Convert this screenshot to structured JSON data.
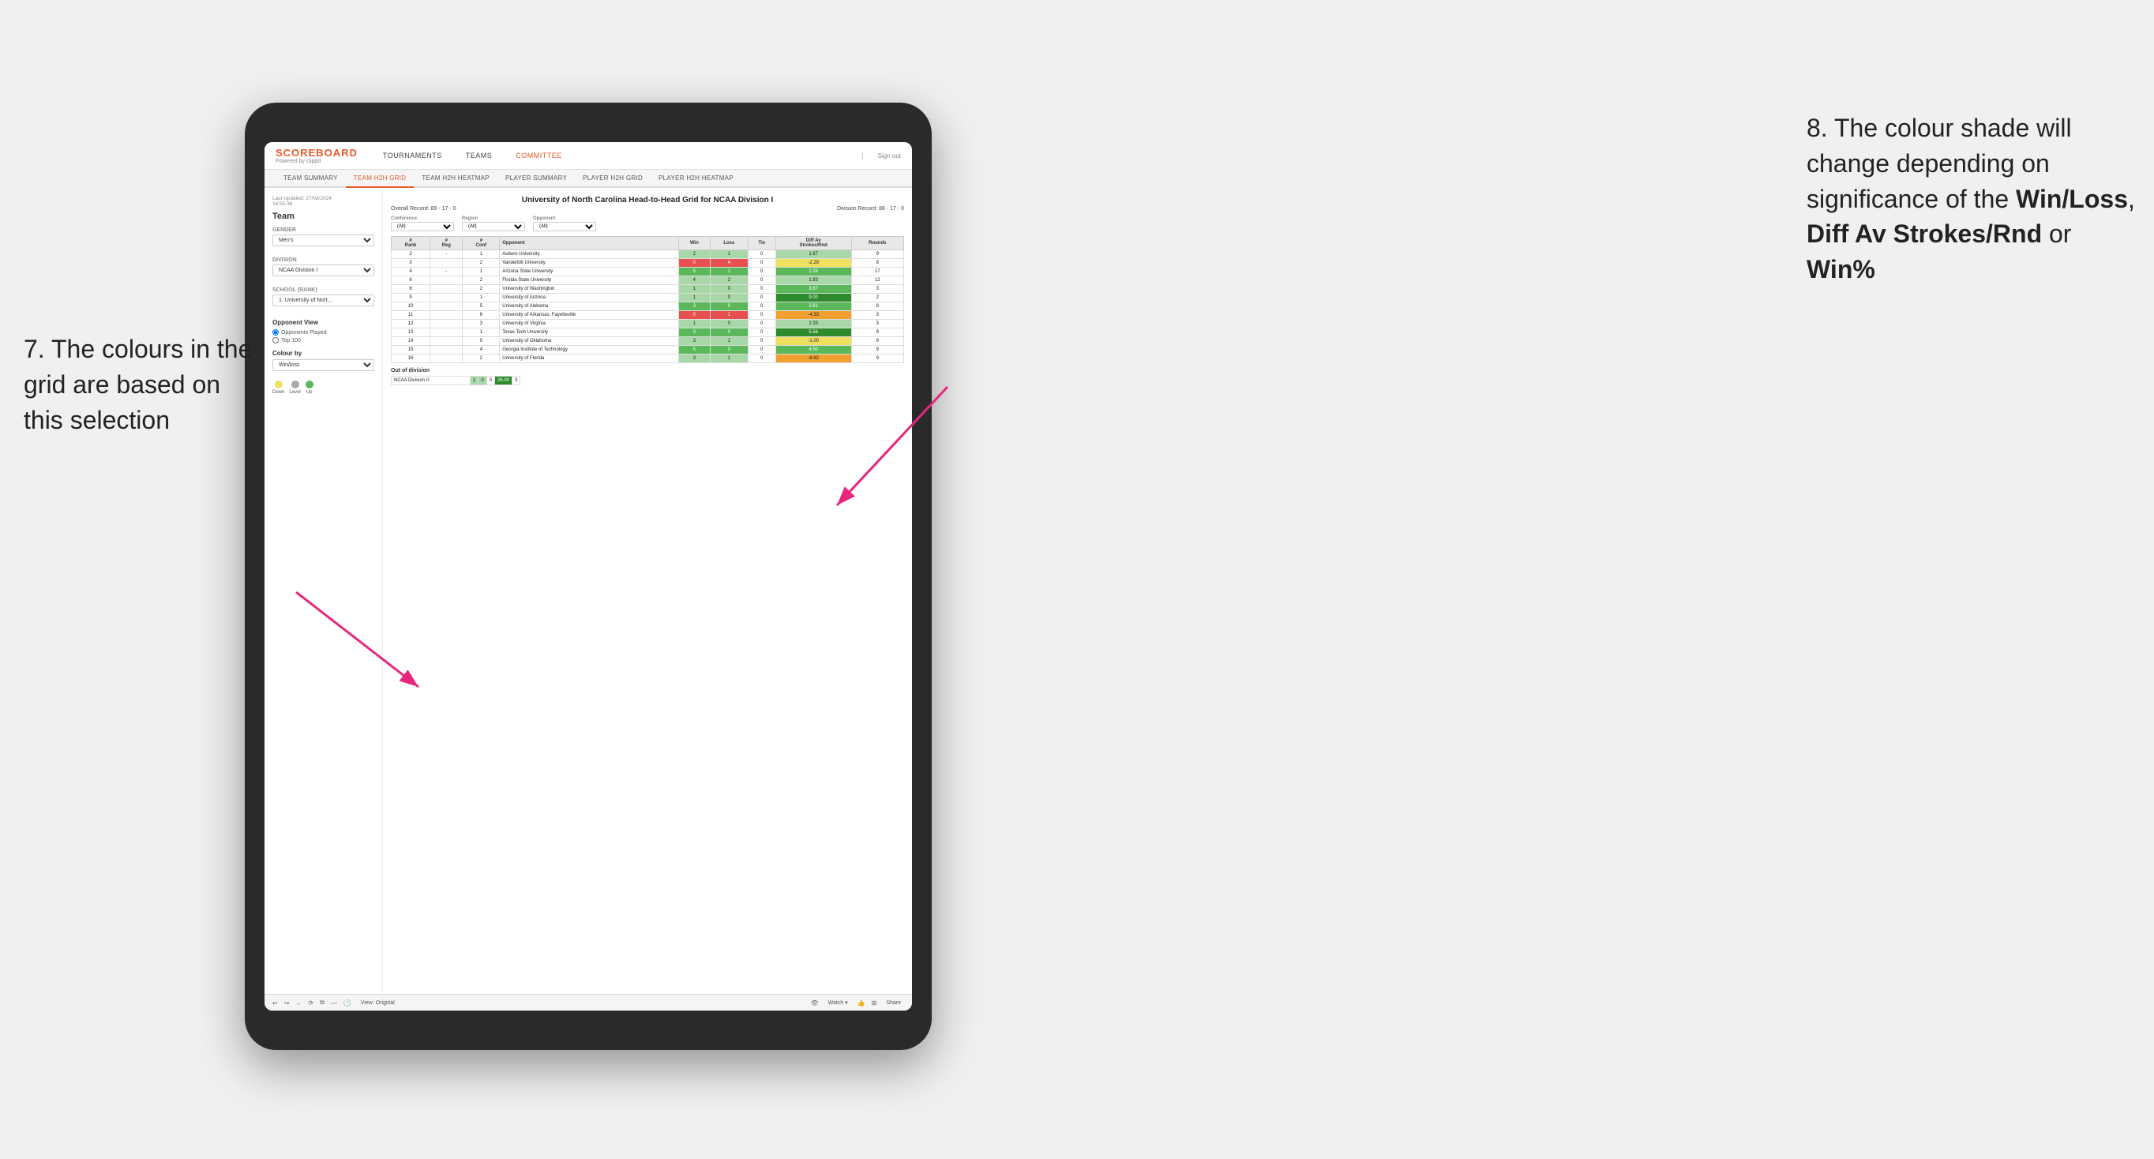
{
  "annotations": {
    "left_text": "7. The colours in the grid are based on this selection",
    "right_text_1": "8. The colour shade will change depending on significance of the ",
    "right_bold_1": "Win/Loss",
    "right_text_2": ", ",
    "right_bold_2": "Diff Av Strokes/Rnd",
    "right_text_3": " or ",
    "right_bold_3": "Win%"
  },
  "nav": {
    "logo": "SCOREBOARD",
    "logo_sub": "Powered by clippd",
    "items": [
      "TOURNAMENTS",
      "TEAMS",
      "COMMITTEE"
    ],
    "sign_out": "Sign out"
  },
  "sub_nav": {
    "items": [
      "TEAM SUMMARY",
      "TEAM H2H GRID",
      "TEAM H2H HEATMAP",
      "PLAYER SUMMARY",
      "PLAYER H2H GRID",
      "PLAYER H2H HEATMAP"
    ],
    "active": "TEAM H2H GRID"
  },
  "sidebar": {
    "last_updated": "Last Updated: 27/03/2024\n16:55:38",
    "team_label": "Team",
    "gender_label": "Gender",
    "gender_value": "Men's",
    "division_label": "Division",
    "division_value": "NCAA Division I",
    "school_label": "School (Rank)",
    "school_value": "1. University of Nort...",
    "opponent_view_label": "Opponent View",
    "radio_options": [
      "Opponents Played",
      "Top 100"
    ],
    "colour_by_label": "Colour by",
    "colour_by_value": "Win/loss",
    "legend": [
      {
        "label": "Down",
        "color": "#f0e060"
      },
      {
        "label": "Level",
        "color": "#aaaaaa"
      },
      {
        "label": "Up",
        "color": "#5ab85a"
      }
    ]
  },
  "grid": {
    "title": "University of North Carolina Head-to-Head Grid for NCAA Division I",
    "overall_record": "Overall Record: 89 - 17 - 0",
    "division_record": "Division Record: 88 - 17 - 0",
    "filters": {
      "conference_label": "Conference",
      "conference_value": "(All)",
      "region_label": "Region",
      "region_value": "(All)",
      "opponent_label": "Opponent",
      "opponent_value": "(All)"
    },
    "columns": [
      "#\nRank",
      "#\nReg",
      "#\nConf",
      "Opponent",
      "Win",
      "Loss",
      "Tie",
      "Diff Av\nStrokes/Rnd",
      "Rounds"
    ],
    "rows": [
      {
        "rank": "2",
        "reg": "-",
        "conf": "1",
        "opponent": "Auburn University",
        "win": "2",
        "loss": "1",
        "tie": "0",
        "diff": "1.67",
        "rounds": "9",
        "win_color": "green-light",
        "diff_color": "green-light"
      },
      {
        "rank": "3",
        "reg": "",
        "conf": "2",
        "opponent": "Vanderbilt University",
        "win": "0",
        "loss": "4",
        "tie": "0",
        "diff": "-2.29",
        "rounds": "8",
        "win_color": "red",
        "diff_color": "yellow"
      },
      {
        "rank": "4",
        "reg": "-",
        "conf": "1",
        "opponent": "Arizona State University",
        "win": "5",
        "loss": "1",
        "tie": "0",
        "diff": "2.28",
        "rounds": "17",
        "win_color": "green-med",
        "diff_color": "green-med"
      },
      {
        "rank": "6",
        "reg": "",
        "conf": "2",
        "opponent": "Florida State University",
        "win": "4",
        "loss": "2",
        "tie": "0",
        "diff": "1.83",
        "rounds": "12",
        "win_color": "green-light",
        "diff_color": "green-light"
      },
      {
        "rank": "8",
        "reg": "",
        "conf": "2",
        "opponent": "University of Washington",
        "win": "1",
        "loss": "0",
        "tie": "0",
        "diff": "3.67",
        "rounds": "3",
        "win_color": "green-light",
        "diff_color": "green-med"
      },
      {
        "rank": "9",
        "reg": "",
        "conf": "1",
        "opponent": "University of Arizona",
        "win": "1",
        "loss": "0",
        "tie": "0",
        "diff": "9.00",
        "rounds": "2",
        "win_color": "green-light",
        "diff_color": "green-dark"
      },
      {
        "rank": "10",
        "reg": "",
        "conf": "5",
        "opponent": "University of Alabama",
        "win": "3",
        "loss": "0",
        "tie": "0",
        "diff": "2.61",
        "rounds": "8",
        "win_color": "green-med",
        "diff_color": "green-med"
      },
      {
        "rank": "11",
        "reg": "",
        "conf": "6",
        "opponent": "University of Arkansas, Fayetteville",
        "win": "0",
        "loss": "1",
        "tie": "0",
        "diff": "-4.33",
        "rounds": "3",
        "win_color": "red",
        "diff_color": "orange"
      },
      {
        "rank": "12",
        "reg": "",
        "conf": "3",
        "opponent": "University of Virginia",
        "win": "1",
        "loss": "0",
        "tie": "0",
        "diff": "2.33",
        "rounds": "3",
        "win_color": "green-light",
        "diff_color": "green-light"
      },
      {
        "rank": "13",
        "reg": "",
        "conf": "1",
        "opponent": "Texas Tech University",
        "win": "3",
        "loss": "0",
        "tie": "0",
        "diff": "5.56",
        "rounds": "9",
        "win_color": "green-med",
        "diff_color": "green-dark"
      },
      {
        "rank": "14",
        "reg": "",
        "conf": "0",
        "opponent": "University of Oklahoma",
        "win": "3",
        "loss": "1",
        "tie": "0",
        "diff": "-1.00",
        "rounds": "9",
        "win_color": "green-light",
        "diff_color": "yellow"
      },
      {
        "rank": "15",
        "reg": "",
        "conf": "4",
        "opponent": "Georgia Institute of Technology",
        "win": "5",
        "loss": "0",
        "tie": "0",
        "diff": "4.50",
        "rounds": "9",
        "win_color": "green-med",
        "diff_color": "green-med"
      },
      {
        "rank": "16",
        "reg": "",
        "conf": "2",
        "opponent": "University of Florida",
        "win": "3",
        "loss": "1",
        "tie": "0",
        "diff": "-6.62",
        "rounds": "9",
        "win_color": "green-light",
        "diff_color": "orange"
      }
    ],
    "out_of_division_label": "Out of division",
    "out_of_division_rows": [
      {
        "opponent": "NCAA Division II",
        "win": "1",
        "loss": "0",
        "tie": "0",
        "diff": "26.00",
        "rounds": "3",
        "diff_color": "green-dark"
      }
    ]
  },
  "toolbar": {
    "view_label": "View: Original",
    "watch_label": "Watch ▾",
    "share_label": "Share"
  }
}
